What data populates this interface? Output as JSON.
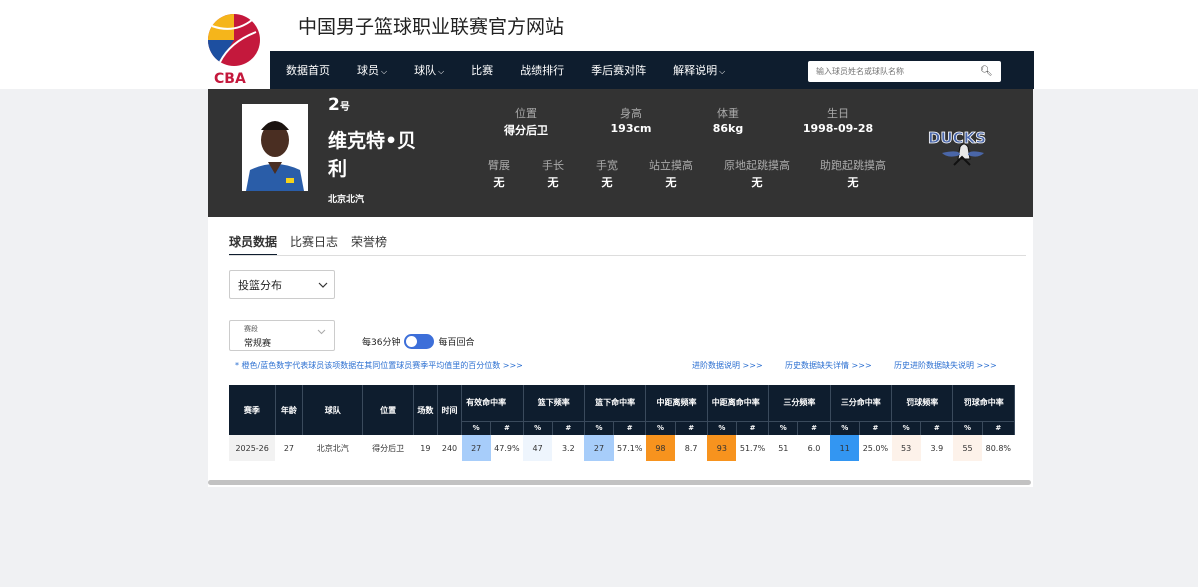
{
  "site": {
    "title": "中国男子篮球职业联赛官方网站",
    "logo_text": "CBA"
  },
  "nav": {
    "items": [
      {
        "label": "数据首页",
        "chev": ""
      },
      {
        "label": "球员",
        "chev": "⌵"
      },
      {
        "label": "球队",
        "chev": "⌵"
      },
      {
        "label": "比赛",
        "chev": ""
      },
      {
        "label": "战绩排行",
        "chev": ""
      },
      {
        "label": "季后赛对阵",
        "chev": ""
      },
      {
        "label": "解释说明",
        "chev": "⌵"
      }
    ],
    "search_placeholder": "输入球员姓名或球队名称"
  },
  "player": {
    "number": "2",
    "number_suffix": "号",
    "name": "维克特•贝利",
    "team": "北京北汽",
    "stats_row1": [
      {
        "label": "位置",
        "value": "得分后卫"
      },
      {
        "label": "身高",
        "value": "193cm"
      },
      {
        "label": "体重",
        "value": "86kg"
      },
      {
        "label": "生日",
        "value": "1998-09-28"
      }
    ],
    "stats_row2": [
      {
        "label": "臂展",
        "value": "无"
      },
      {
        "label": "手长",
        "value": "无"
      },
      {
        "label": "手宽",
        "value": "无"
      },
      {
        "label": "站立摸高",
        "value": "无"
      },
      {
        "label": "原地起跳摸高",
        "value": "无"
      },
      {
        "label": "助跑起跳摸高",
        "value": "无"
      }
    ],
    "team_logo_text": "DUCKS"
  },
  "tabs": [
    "球员数据",
    "比赛日志",
    "荣誉榜"
  ],
  "filters": {
    "select1": "投篮分布",
    "select2_label": "赛段",
    "select2_value": "常规赛",
    "toggle_left": "每36分钟",
    "toggle_right": "每百回合"
  },
  "notes": {
    "left": "* 橙色/蓝色数字代表球员该项数据在其同位置球员赛季平均值里的百分位数 >>>",
    "link1": "进阶数据说明 >>>",
    "link2": "历史数据缺失详情 >>>",
    "link3": "历史进阶数据缺失说明 >>>"
  },
  "table": {
    "fixed_headers": [
      "赛季",
      "年龄",
      "球队",
      "位置",
      "场数",
      "时间"
    ],
    "group_headers": [
      "有效命中率",
      "篮下频率",
      "篮下命中率",
      "中距离频率",
      "中距离命中率",
      "三分频率",
      "三分命中率",
      "罚球频率",
      "罚球命中率"
    ],
    "sub_pct": "%",
    "sub_num": "#",
    "row": {
      "season": "2025-26",
      "age": "27",
      "team": "北京北汽",
      "position": "得分后卫",
      "games": "19",
      "minutes": "240",
      "groups": [
        {
          "pct": "27",
          "num": "47.9%"
        },
        {
          "pct": "47",
          "num": "3.2"
        },
        {
          "pct": "27",
          "num": "57.1%"
        },
        {
          "pct": "98",
          "num": "8.7"
        },
        {
          "pct": "93",
          "num": "51.7%"
        },
        {
          "pct": "51",
          "num": "6.0"
        },
        {
          "pct": "11",
          "num": "25.0%"
        },
        {
          "pct": "53",
          "num": "3.9"
        },
        {
          "pct": "55",
          "num": "80.8%"
        }
      ]
    }
  },
  "colors": {
    "navy": "#0e1d2e",
    "hero": "#333333",
    "orange": "#f7931e",
    "blue": "#3396f2",
    "lightblue": "#a7cdfa",
    "link": "#2b6fd1"
  }
}
